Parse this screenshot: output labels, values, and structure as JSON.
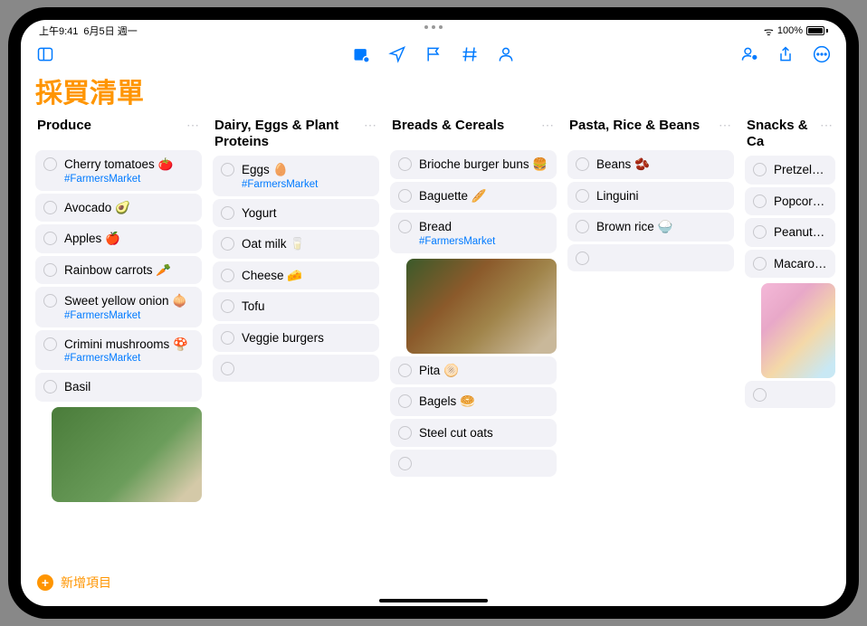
{
  "status": {
    "time": "上午9:41",
    "date": "6月5日 週一",
    "battery": "100%"
  },
  "title": "採買清單",
  "toolbar": {
    "add_label": "新增項目"
  },
  "columns": [
    {
      "title": "Produce",
      "items": [
        {
          "label": "Cherry tomatoes 🍅",
          "tag": "#FarmersMarket"
        },
        {
          "label": "Avocado 🥑"
        },
        {
          "label": "Apples 🍎"
        },
        {
          "label": "Rainbow carrots 🥕"
        },
        {
          "label": "Sweet yellow onion 🧅",
          "tag": "#FarmersMarket"
        },
        {
          "label": "Crimini mushrooms 🍄",
          "tag": "#FarmersMarket"
        },
        {
          "label": "Basil",
          "image": "basil"
        }
      ]
    },
    {
      "title": "Dairy, Eggs & Plant Proteins",
      "items": [
        {
          "label": "Eggs 🥚",
          "tag": "#FarmersMarket"
        },
        {
          "label": "Yogurt"
        },
        {
          "label": "Oat milk 🥛"
        },
        {
          "label": "Cheese 🧀"
        },
        {
          "label": "Tofu"
        },
        {
          "label": "Veggie burgers"
        },
        {
          "empty": true
        }
      ]
    },
    {
      "title": "Breads & Cereals",
      "items": [
        {
          "label": "Brioche burger buns 🍔"
        },
        {
          "label": "Baguette 🥖"
        },
        {
          "label": "Bread",
          "tag": "#FarmersMarket",
          "image": "bread"
        },
        {
          "label": "Pita 🫓"
        },
        {
          "label": "Bagels 🥯"
        },
        {
          "label": "Steel cut oats"
        },
        {
          "empty": true
        }
      ]
    },
    {
      "title": "Pasta, Rice & Beans",
      "items": [
        {
          "label": "Beans 🫘"
        },
        {
          "label": "Linguini"
        },
        {
          "label": "Brown rice 🍚"
        },
        {
          "empty": true
        }
      ]
    },
    {
      "title": "Snacks & Ca",
      "items": [
        {
          "label": "Pretzels 🥨"
        },
        {
          "label": "Popcorn 🍿"
        },
        {
          "label": "Peanuts 🥜"
        },
        {
          "label": "Macarons",
          "image": "macarons"
        },
        {
          "empty": true
        }
      ]
    }
  ]
}
